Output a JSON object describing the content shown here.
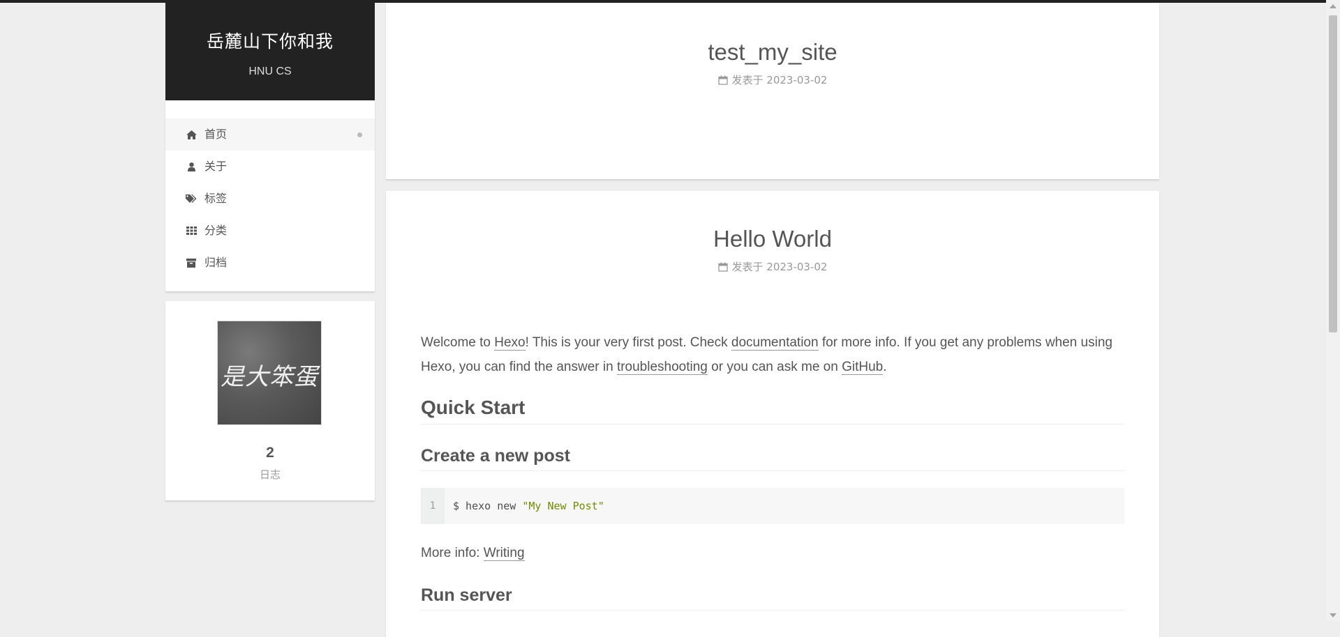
{
  "site": {
    "title": "岳麓山下你和我",
    "subtitle": "HNU CS"
  },
  "menu": [
    {
      "label": "首页",
      "icon": "home-icon",
      "active": true
    },
    {
      "label": "关于",
      "icon": "user-icon"
    },
    {
      "label": "标签",
      "icon": "tags-icon"
    },
    {
      "label": "分类",
      "icon": "th-icon"
    },
    {
      "label": "归档",
      "icon": "archive-icon"
    }
  ],
  "author": {
    "avatar_text": "是大笨蛋",
    "post_count": "2",
    "post_label": "日志"
  },
  "posts": [
    {
      "title": "test_my_site",
      "meta": "发表于 2023-03-02"
    },
    {
      "title": "Hello World",
      "meta": "发表于 2023-03-02"
    }
  ],
  "article": {
    "p1_a": "Welcome to ",
    "p1_link1": "Hexo",
    "p1_b": "! This is your very first post. Check ",
    "p1_link2": "documentation",
    "p1_c": " for more info. If you get any problems when using Hexo, you can find the answer in ",
    "p1_link3": "troubleshooting",
    "p1_d": " or you can ask me on ",
    "p1_link4": "GitHub",
    "p1_e": ".",
    "h_quick_start": "Quick Start",
    "h_create_post": "Create a new post",
    "code_line_no": "1",
    "code_cmd": "$ hexo new ",
    "code_str": "\"My New Post\"",
    "more_label": "More info: ",
    "more_link": "Writing",
    "h_run_server": "Run server"
  }
}
